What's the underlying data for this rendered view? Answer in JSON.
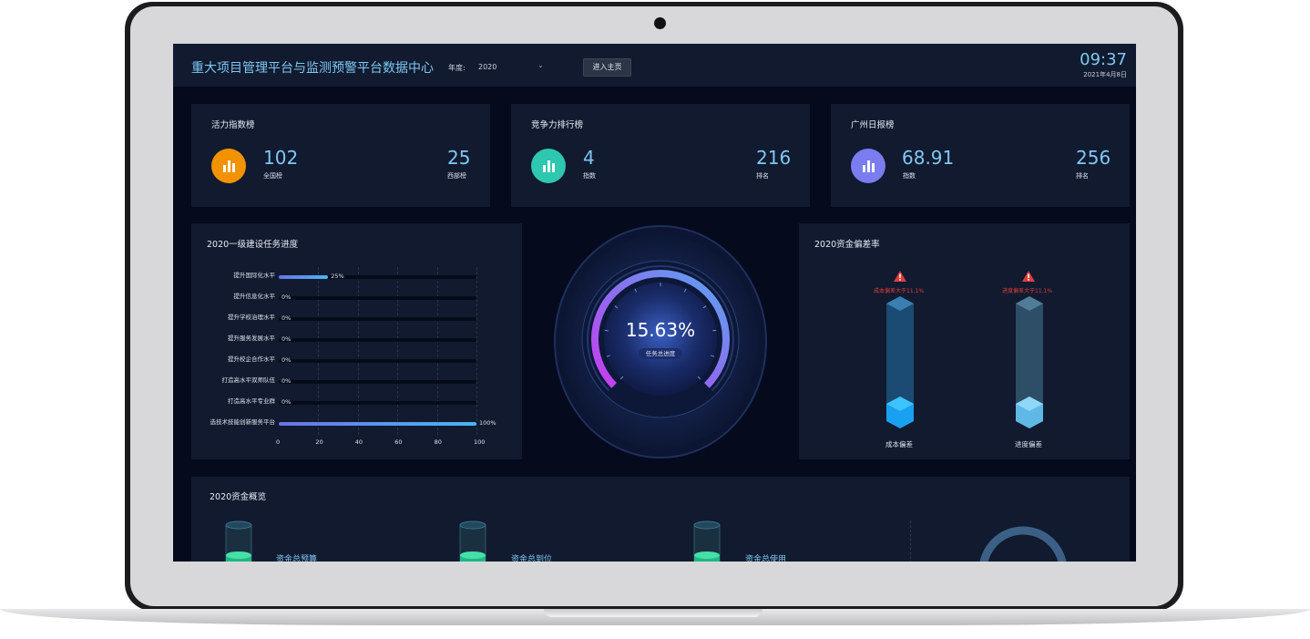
{
  "header": {
    "title": "重大项目管理平台与监测预警平台数据中心",
    "year_label": "年度:",
    "year_value": "2020",
    "home_button": "进入主页",
    "time": "09:37",
    "date": "2021年4月8日"
  },
  "stat_cards": [
    {
      "title": "活力指数榜",
      "primary_value": "102",
      "primary_label": "全国榜",
      "secondary_value": "25",
      "secondary_label": "西部榜",
      "icon": "bar-chart-icon",
      "icon_color": "#f39200"
    },
    {
      "title": "竞争力排行榜",
      "primary_value": "4",
      "primary_label": "指数",
      "secondary_value": "216",
      "secondary_label": "排名",
      "icon": "bar-chart-icon",
      "icon_color": "#2ec7b0"
    },
    {
      "title": "广州日报榜",
      "primary_value": "68.91",
      "primary_label": "指数",
      "secondary_value": "256",
      "secondary_label": "排名",
      "icon": "bar-chart-icon",
      "icon_color": "#7a7cf0"
    }
  ],
  "chart_data": {
    "type": "bar",
    "orientation": "horizontal",
    "title": "2020一级建设任务进度",
    "categories": [
      "提升国际化水平",
      "提升信息化水平",
      "提升学校治理水平",
      "提升服务发展水平",
      "提升校企合作水平",
      "打造高水平双师队伍",
      "打造高水平专业群",
      "选技术技能创新服务平台"
    ],
    "values": [
      25,
      0,
      0,
      0,
      0,
      0,
      0,
      100
    ],
    "value_labels": [
      "25%",
      "0%",
      "0%",
      "0%",
      "0%",
      "0%",
      "0%",
      "100%"
    ],
    "x_ticks": [
      "0",
      "20",
      "40",
      "60",
      "80",
      "100"
    ],
    "xlim": [
      0,
      100
    ],
    "grid": true
  },
  "gauge": {
    "value": "15.63%",
    "label": "任务总进度",
    "fraction": 0.1563
  },
  "deviation": {
    "title": "2020资金偏差率",
    "items": [
      {
        "label": "成本偏差",
        "warning": "成本偏差大于11.1%",
        "warning_icon": "warning-icon"
      },
      {
        "label": "进度偏差",
        "warning": "进度偏差大于11.1%",
        "warning_icon": "warning-icon"
      }
    ]
  },
  "funds": {
    "title": "2020资金概览",
    "items": [
      {
        "label": "资金总预算"
      },
      {
        "label": "资金总到位"
      },
      {
        "label": "资金总使用"
      }
    ]
  },
  "colors": {
    "screen_bg": "#050a1d",
    "panel_bg": "#111a2e",
    "accent": "#7ec8f4",
    "warning": "#e03c3c"
  }
}
